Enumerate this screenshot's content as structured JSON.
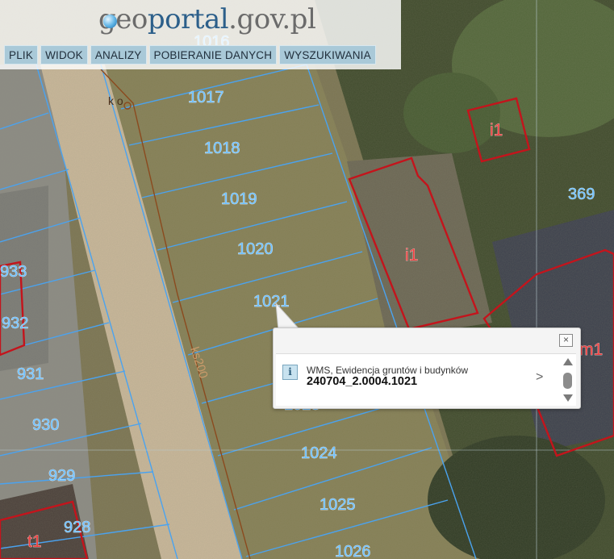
{
  "header": {
    "logo_prefix": "geo",
    "logo_accent": "portal",
    "logo_suffix": ".gov.pl"
  },
  "menu": [
    "PLIK",
    "WIDOK",
    "ANALIZY",
    "POBIERANIE DANYCH",
    "WYSZUKIWANIA"
  ],
  "map": {
    "parcel_numbers": [
      "1016",
      "1017",
      "1018",
      "1019",
      "1020",
      "1021",
      "1023",
      "1024",
      "1025",
      "1026",
      "369",
      "933",
      "932",
      "931",
      "930",
      "929",
      "928"
    ],
    "building_labels": [
      "i1",
      "i1",
      "m1",
      "t1"
    ],
    "road_label": "ks200",
    "small_label": "k o"
  },
  "popup": {
    "source": "WMS, Ewidencja gruntów i budynków",
    "parcel_id": "240704_2.0004.1021",
    "close_symbol": "×",
    "info_symbol": "i",
    "next_symbol": ">"
  },
  "colors": {
    "parcel_line": "#4aa3f0",
    "parcel_label": "#6ec0ff",
    "building_line": "#c4141c",
    "building_label": "#ee3f3f",
    "road_line": "#8b4a1e",
    "menu_bg": "#a9c9d8"
  }
}
